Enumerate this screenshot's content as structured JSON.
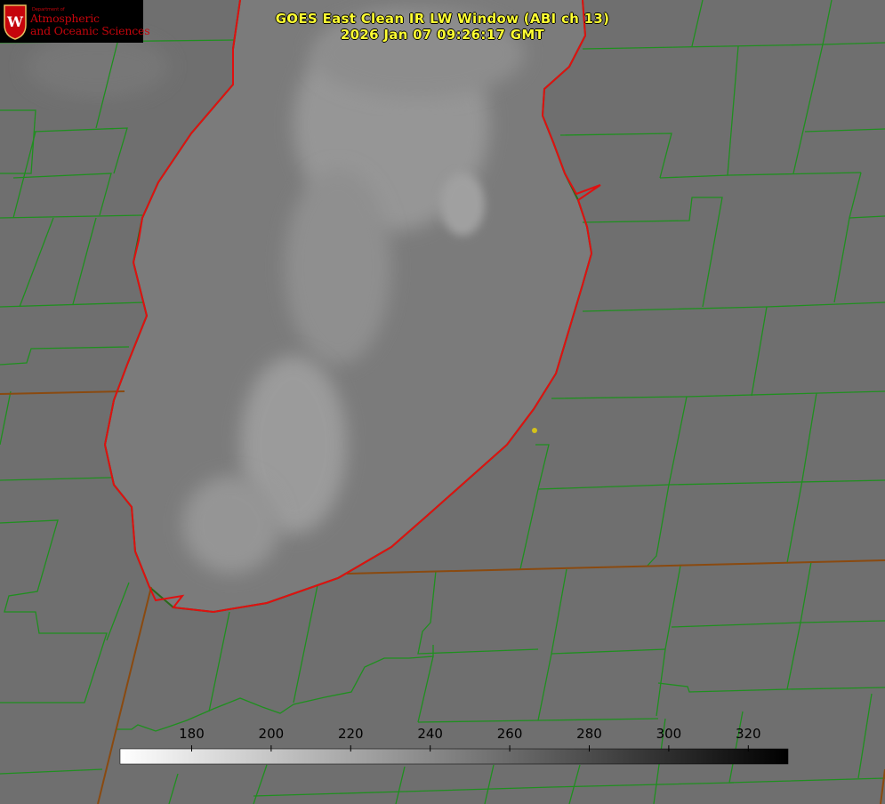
{
  "header": {
    "title": "GOES East Clean IR LW Window (ABI ch 13)",
    "timestamp": "2026 Jan 07 09:26:17 GMT"
  },
  "logo": {
    "department": "Department of",
    "line1": "Atmospheric",
    "line2": "and Oceanic Sciences",
    "seal_letter": "W"
  },
  "colorbar": {
    "min": 162,
    "max": 330,
    "ticks": [
      180,
      200,
      220,
      240,
      260,
      280,
      300,
      320
    ],
    "tick_labels": [
      "180",
      "200",
      "220",
      "240",
      "260",
      "280",
      "300",
      "320"
    ],
    "color_low": "#ffffff",
    "color_high": "#000000"
  },
  "colors": {
    "background": "#6f6f6f",
    "lake": "#7a7a7a",
    "cloud_band": "#9a9a9a",
    "county_lines": "#1f8f1f",
    "shoreline": "#e01010",
    "title_text": "#ffff33",
    "marker": "#d4c21a",
    "logo_red": "#c5050c"
  },
  "map": {
    "feature": "lake-shoreline",
    "marker": "yellow-dot"
  }
}
